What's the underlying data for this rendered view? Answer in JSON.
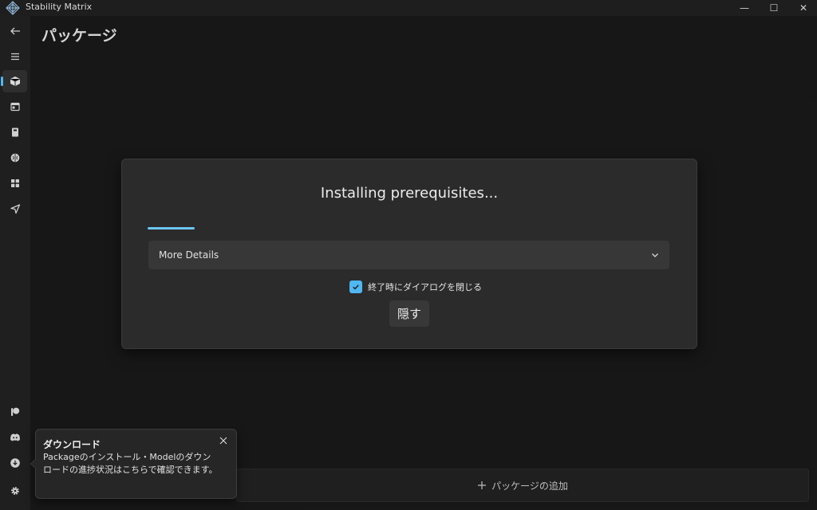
{
  "window": {
    "title": "Stability Matrix",
    "controls": {
      "minimize": "—",
      "maximize": "☐",
      "close": "✕"
    }
  },
  "sidebar": {
    "items": [
      {
        "name": "back",
        "icon": "back-arrow-icon"
      },
      {
        "name": "menu",
        "icon": "hamburger-icon"
      },
      {
        "name": "packages",
        "icon": "package-box-icon",
        "selected": true
      },
      {
        "name": "inference",
        "icon": "window-icon"
      },
      {
        "name": "checkpoints",
        "icon": "notebook-icon"
      },
      {
        "name": "model-browser",
        "icon": "brain-icon"
      },
      {
        "name": "workflows",
        "icon": "grid-icon"
      },
      {
        "name": "output",
        "icon": "send-icon"
      },
      {
        "name": "patreon",
        "icon": "patreon-icon"
      },
      {
        "name": "discord",
        "icon": "discord-icon"
      },
      {
        "name": "downloads",
        "icon": "download-icon"
      },
      {
        "name": "settings",
        "icon": "gear-icon"
      }
    ],
    "accent": "#4fb7f2"
  },
  "main": {
    "page_title": "パッケージ",
    "add_package_label": "パッケージの追加",
    "add_icon": "plus-icon"
  },
  "dialog": {
    "title": "Installing prerequisites...",
    "progress_indeterminate": true,
    "expander_label": "More Details",
    "close_on_finish_label": "終了時にダイアログを閉じる",
    "close_on_finish_checked": true,
    "hide_button_label": "隠す"
  },
  "teaching_tip": {
    "title": "ダウンロード",
    "body": "Packageのインストール・Modelのダウンロードの進捗状況はこちらで確認できます。"
  },
  "colors": {
    "background": "#1b1b1b",
    "dialog": "#2b2b2b",
    "accent": "#4fb7f2",
    "progress": "#6cc6f2"
  }
}
